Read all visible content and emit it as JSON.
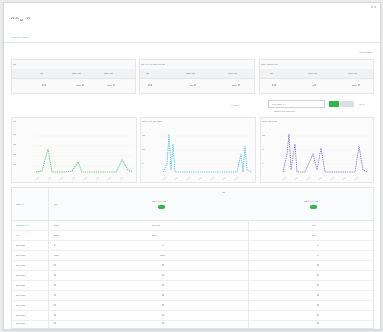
{
  "topbar": {
    "right_text": "✕ ≡"
  },
  "page": {
    "title": "ᴖᴖᴗ ᴖ",
    "subtitle": "ᴗ  ᴗᴗᴗ ᴗ ᴗᴗᴗᴗ",
    "breadcrumb_right": "ᴗᴗᴗ ᴗᴗᴗᴗ"
  },
  "cards": [
    {
      "title": "ᴗᴗ",
      "cols": [
        "ᴗᴗ",
        "ᴗᴗᴗ ᴗᴗ",
        "ᴗᴗᴗ ᴗᴗ"
      ],
      "vals": [
        "1\n0",
        "ᴗᴗᴗ\n0",
        "ᴗᴗᴗ\n0"
      ]
    },
    {
      "title": "ᴗᴗ ᴗ ᴗ ᴗ ᴗᴗᴗ ᴗᴗᴗᴗ",
      "cols": [
        "ᴗᴗ",
        "ᴗᴗᴗ ᴗᴗ",
        "ᴗᴗᴗ ᴗᴗ"
      ],
      "vals": [
        "2\n0",
        "ᴗᴗ\n0",
        "ᴗᴗᴗ\n0"
      ]
    },
    {
      "title": "ᴗᴗᴗ ᴗᴗᴗᴗ ᴗᴗ",
      "cols": [
        "ᴗᴗ",
        "ᴗᴗᴗ ᴗᴗ",
        "ᴗᴗᴗ ᴗᴗ"
      ],
      "vals": [
        "1\n0",
        "ᴗ\n0",
        "ᴗᴗᴗ\n0"
      ]
    }
  ],
  "controls": {
    "filter_label": "ᴗ ᴗᴗᴗ",
    "date_range": "ᴗ  ᴗ  ᴗᴗᴗ  ᴗ",
    "date_sub": "ᴗᴗᴗᴗ ᴗᴗ ᴗᴗᴗ ᴗᴗ",
    "right_label": "ᴗᴗ ᴗ"
  },
  "charts": [
    {
      "title": "ᴗᴗ",
      "color": "#2db84d",
      "yticks": [
        "ᴗᴗ",
        "ᴗᴗ",
        "ᴗᴗ",
        "ᴗᴗ",
        "ᴗ"
      ]
    },
    {
      "title": "ᴗᴗᴗ ᴗ ᴗ ᴗᴗ ᴗᴗᴗ",
      "color": "#25b7e6",
      "yticks": [
        "ᴗᴗ",
        "ᴗᴗ",
        "ᴗ"
      ]
    },
    {
      "title": "ᴗᴗᴗ ᴗᴗᴗ ᴗᴗ",
      "color": "#6a4fd0",
      "yticks": [
        "ᴗᴗ",
        "ᴗ",
        "ᴗ"
      ]
    }
  ],
  "table": {
    "group_header": "ᴗᴗ",
    "col1": "ᴗᴗᴗ ᴗ",
    "col2": "ᴗᴗ",
    "col3": "ᴗᴗᴗ ᴗ ᴗ ᴗᴗ",
    "col4": "ᴗᴗᴗ ᴗ ᴗ ᴗᴗ",
    "rows": [
      [
        "ᴗᴗᴗᴗᴗ ᴗᴗ",
        "ᴗᴗᴗ",
        "ᴗ ᴗ ᴗᴗ",
        "ᴗᴗ"
      ],
      [
        "ᴗᴗ",
        "ᴗᴗᴗ",
        "ᴗᴗᴗ",
        "ᴗᴗ"
      ],
      [
        "ᴗᴗ ᴗᴗᴗ",
        "1",
        "ᴗ",
        "ᴗ"
      ],
      [
        "ᴗᴗ ᴗᴗᴗ",
        "ᴗᴗᴗ",
        "ᴗᴗᴗ",
        "ᴗ"
      ],
      [
        "ᴗᴗ ᴗᴗᴗ",
        "0",
        "0",
        "0"
      ],
      [
        "ᴗᴗ ᴗᴗᴗ",
        "0",
        "0",
        "0"
      ],
      [
        "ᴗᴗ ᴗᴗᴗ",
        "0",
        "0",
        "0"
      ],
      [
        "ᴗᴗ ᴗᴗᴗ",
        "0",
        "0",
        "0"
      ],
      [
        "ᴗᴗ ᴗᴗᴗ",
        "0",
        "0",
        "0"
      ],
      [
        "ᴗᴗ ᴗᴗᴗ",
        "0",
        "0",
        "0"
      ],
      [
        "ᴗᴗ ᴗᴗᴗ",
        "0",
        "0",
        "0"
      ]
    ]
  }
}
